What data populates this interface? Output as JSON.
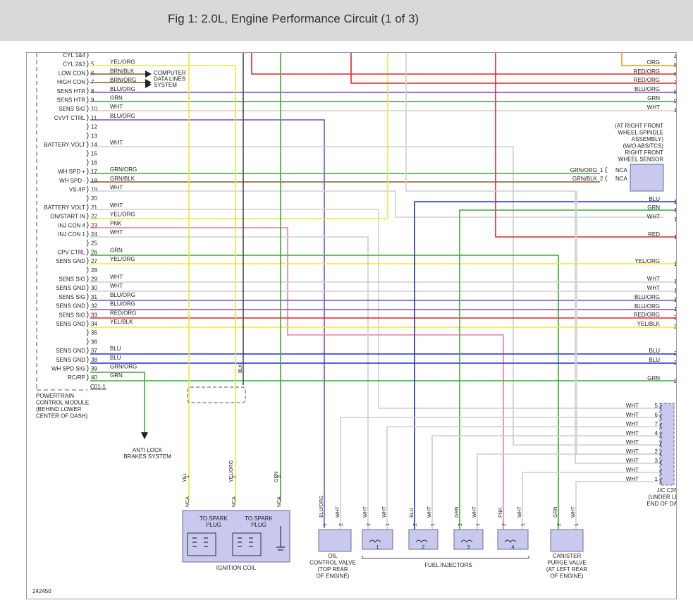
{
  "title": "Fig 1: 2.0L, Engine Performance Circuit (1 of 3)",
  "figure_number": "242450",
  "pcm": {
    "connector": "C01-1",
    "caption": [
      "POWERTRAIN",
      "CONTROL MODULE",
      "(BEHIND LOWER",
      "CENTER OF DASH)"
    ]
  },
  "pcm_pins": [
    {
      "pin": "",
      "label": "CYL 1&4",
      "wire": ""
    },
    {
      "pin": "5",
      "label": "CYL 2&3",
      "wire": "YEL/ORG"
    },
    {
      "pin": "6",
      "label": "LOW CON",
      "wire": "BRN/BLK"
    },
    {
      "pin": "7",
      "label": "HIGH CON",
      "wire": "BRN/ORG"
    },
    {
      "pin": "8",
      "label": "SENS HTR",
      "wire": "BLU/ORG"
    },
    {
      "pin": "9",
      "label": "SENS HTR",
      "wire": "GRN"
    },
    {
      "pin": "10",
      "label": "SENS SIG",
      "wire": "WHT"
    },
    {
      "pin": "11",
      "label": "CVVT CTRL",
      "wire": "BLU/ORG"
    },
    {
      "pin": "12",
      "label": "",
      "wire": ""
    },
    {
      "pin": "13",
      "label": "",
      "wire": ""
    },
    {
      "pin": "14",
      "label": "BATTERY VOLT",
      "wire": "WHT"
    },
    {
      "pin": "15",
      "label": "",
      "wire": ""
    },
    {
      "pin": "16",
      "label": "",
      "wire": ""
    },
    {
      "pin": "17",
      "label": "WH SPD +",
      "wire": "GRN/ORG"
    },
    {
      "pin": "18",
      "label": "WH SPD -",
      "wire": "GRN/BLK"
    },
    {
      "pin": "19",
      "label": "VS-/IP",
      "wire": "WHT"
    },
    {
      "pin": "20",
      "label": "",
      "wire": ""
    },
    {
      "pin": "21",
      "label": "BATTERY VOLT",
      "wire": "WHT"
    },
    {
      "pin": "22",
      "label": "ON/START IN",
      "wire": "YEL/ORG"
    },
    {
      "pin": "23",
      "label": "INJ CON 4",
      "wire": "PNK"
    },
    {
      "pin": "24",
      "label": "INJ CON 1",
      "wire": "WHT"
    },
    {
      "pin": "25",
      "label": "",
      "wire": ""
    },
    {
      "pin": "26",
      "label": "CPV CTRL",
      "wire": "GRN"
    },
    {
      "pin": "27",
      "label": "SENS GND",
      "wire": "YEL/ORG"
    },
    {
      "pin": "28",
      "label": "",
      "wire": ""
    },
    {
      "pin": "29",
      "label": "SENS SIG",
      "wire": "WHT"
    },
    {
      "pin": "30",
      "label": "SENS GND",
      "wire": "WHT"
    },
    {
      "pin": "31",
      "label": "SENS SIG",
      "wire": "BLU/ORG"
    },
    {
      "pin": "32",
      "label": "SENS GND",
      "wire": "BLU/ORG"
    },
    {
      "pin": "33",
      "label": "SENS SIG",
      "wire": "RED/ORG"
    },
    {
      "pin": "34",
      "label": "SENS GND",
      "wire": "YEL/BLK"
    },
    {
      "pin": "35",
      "label": "",
      "wire": ""
    },
    {
      "pin": "36",
      "label": "",
      "wire": ""
    },
    {
      "pin": "37",
      "label": "SENS GND",
      "wire": "BLU"
    },
    {
      "pin": "38",
      "label": "SENS GND",
      "wire": "BLU"
    },
    {
      "pin": "39",
      "label": "WH SPD SIG",
      "wire": "GRN/ORG"
    },
    {
      "pin": "40",
      "label": "RC/RP",
      "wire": "GRN"
    }
  ],
  "computer_data_lines": [
    "COMPUTER",
    "DATA LINES",
    "SYSTEM"
  ],
  "anti_lock": [
    "ANTI LOCK",
    "BRAKES SYSTEM"
  ],
  "right_refs": [
    {
      "num": "4",
      "wire": ""
    },
    {
      "num": "5",
      "wire": "ORG"
    },
    {
      "num": "6",
      "wire": "RED/ORG"
    },
    {
      "num": "7",
      "wire": "RED/ORG"
    },
    {
      "num": "8",
      "wire": "BLU/ORG"
    },
    {
      "num": "9",
      "wire": "GRN"
    },
    {
      "num": "10",
      "wire": "WHT"
    },
    {
      "num": "11",
      "wire": "BLU"
    },
    {
      "num": "12",
      "wire": "GRN"
    },
    {
      "num": "13",
      "wire": "WHT"
    },
    {
      "num": "14",
      "wire": "RED"
    },
    {
      "num": "15",
      "wire": "YEL/ORG"
    },
    {
      "num": "16",
      "wire": "WHT"
    },
    {
      "num": "17",
      "wire": "WHT"
    },
    {
      "num": "18",
      "wire": "BLU/ORG"
    },
    {
      "num": "19",
      "wire": "BLU/ORG"
    },
    {
      "num": "20",
      "wire": "RED/ORG"
    },
    {
      "num": "21",
      "wire": "YEL/BLK"
    },
    {
      "num": "22",
      "wire": "BLU"
    },
    {
      "num": "23",
      "wire": "BLU"
    },
    {
      "num": "24",
      "wire": "GRN"
    }
  ],
  "wheel_sensor": {
    "caption": [
      "(AT RIGHT FRONT",
      "WHEEL SPINDLE",
      "ASSEMBLY)",
      "(W/O ABS/TCS)",
      "RIGHT FRONT",
      "WHEEL SENSOR"
    ],
    "pins": [
      {
        "wire": "GRN/ORG",
        "pin": "1",
        "nca": "NCA"
      },
      {
        "wire": "GRN/BLK",
        "pin": "2",
        "nca": "NCA"
      }
    ]
  },
  "jc": {
    "caption": [
      "J/C C26",
      "(UNDER LEFT",
      "END OF DASH)"
    ],
    "pins": [
      {
        "wire": "WHT",
        "pin": "5"
      },
      {
        "wire": "WHT",
        "pin": "6"
      },
      {
        "wire": "WHT",
        "pin": "7"
      },
      {
        "wire": "WHT",
        "pin": "4"
      },
      {
        "wire": "WHT",
        "pin": ""
      },
      {
        "wire": "WHT",
        "pin": "2"
      },
      {
        "wire": "WHT",
        "pin": "3"
      },
      {
        "wire": "WHT",
        "pin": ""
      },
      {
        "wire": "WHT",
        "pin": "1"
      }
    ]
  },
  "ignition": {
    "caption": "IGNITION COIL",
    "to_plug_1": [
      "TO SPARK",
      "PLUG"
    ],
    "to_plug_2": [
      "TO SPARK",
      "PLUG"
    ],
    "pins": [
      {
        "wire": "YEL",
        "pin": "1",
        "nca": "NCA"
      },
      {
        "wire": "YEL/ORG",
        "pin": "2",
        "nca": "NCA"
      },
      {
        "wire": "GRN",
        "pin": "3",
        "nca": "NCA"
      }
    ]
  },
  "blk_wire": "BLK",
  "oil_valve": {
    "caption": [
      "OIL",
      "CONTROL VALVE",
      "(TOP REAR",
      "OF ENGINE)"
    ],
    "pins": [
      {
        "pin": "1",
        "wire": "BLU/ORG"
      },
      {
        "pin": "2",
        "wire": "WHT"
      }
    ]
  },
  "injectors": {
    "caption": "FUEL INJECTORS",
    "units": [
      {
        "num": "1",
        "w1": "WHT",
        "w2": "WHT"
      },
      {
        "num": "2",
        "w1": "BLU",
        "w2": "WHT"
      },
      {
        "num": "3",
        "w1": "GRN",
        "w2": "WHT"
      },
      {
        "num": "4",
        "w1": "PNK",
        "w2": "WHT"
      }
    ]
  },
  "canister": {
    "caption": [
      "CANISTER",
      "PURGE VALVE",
      "(AT LEFT REAR",
      "OF ENGINE)"
    ],
    "pins": [
      {
        "pin": "2",
        "wire": "GRN"
      },
      {
        "pin": "1",
        "wire": "WHT"
      }
    ]
  },
  "colors": {
    "YEL": "#f2e53a",
    "ORG": "#f5961e",
    "RED": "#e32626",
    "BLU": "#1f2ed6",
    "GRN": "#3aaa35",
    "WHT": "#cfcfcf",
    "PNK": "#f27ea0",
    "BLK": "#4a4a4a",
    "PURPLE": "#7a4fb8",
    "BRN": "#8a5a2b",
    "component": "#c9c9ef",
    "component_border": "#6a6a9a"
  }
}
